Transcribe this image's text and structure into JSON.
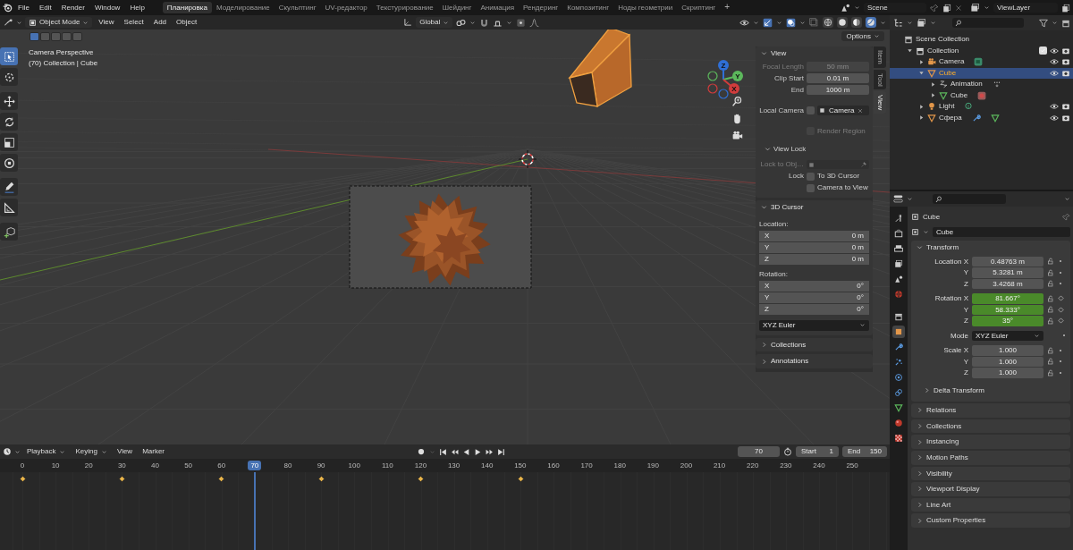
{
  "menu": [
    "File",
    "Edit",
    "Render",
    "Window",
    "Help"
  ],
  "workspaces": [
    {
      "label": "Планировка",
      "selected": true
    },
    {
      "label": "Моделирование",
      "selected": false
    },
    {
      "label": "Скульптинг",
      "selected": false
    },
    {
      "label": "UV-редактор",
      "selected": false
    },
    {
      "label": "Текстурирование",
      "selected": false
    },
    {
      "label": "Шейдинг",
      "selected": false
    },
    {
      "label": "Анимация",
      "selected": false
    },
    {
      "label": "Рендеринг",
      "selected": false
    },
    {
      "label": "Композитинг",
      "selected": false
    },
    {
      "label": "Ноды геометрии",
      "selected": false
    },
    {
      "label": "Скриптинг",
      "selected": false
    }
  ],
  "add_tab": "+",
  "scene": "Scene",
  "view_layer": "ViewLayer",
  "viewport": {
    "mode": "Object Mode",
    "menus": [
      "View",
      "Select",
      "Add",
      "Object"
    ],
    "orientation": "Global",
    "shading": [
      {
        "kind": "wireframe",
        "selected": false
      },
      {
        "kind": "solid",
        "selected": false
      },
      {
        "kind": "material",
        "selected": false
      },
      {
        "kind": "rendered",
        "selected": true
      }
    ],
    "options": "Options",
    "select_modes": [
      {
        "selected": true
      },
      {
        "selected": false
      },
      {
        "selected": false
      },
      {
        "selected": false
      },
      {
        "selected": false
      }
    ],
    "info": [
      "Camera Perspective",
      "(70) Collection | Cube"
    ],
    "tools": [
      {
        "kind": "select",
        "selected": true
      },
      {
        "kind": "cursor",
        "selected": false
      },
      {
        "kind": "move",
        "selected": false
      },
      {
        "kind": "rotate",
        "selected": false
      },
      {
        "kind": "scale",
        "selected": false
      },
      {
        "kind": "transform",
        "selected": false
      },
      {
        "kind": "annotate",
        "selected": false
      },
      {
        "kind": "measure",
        "selected": false
      },
      {
        "kind": "add-cube",
        "selected": false
      }
    ],
    "gizmo": [
      "Z",
      "Y",
      "X"
    ],
    "npanel": {
      "tabs": [
        {
          "label": "Item",
          "selected": false
        },
        {
          "label": "Tool",
          "selected": false
        },
        {
          "label": "View",
          "selected": true
        }
      ],
      "sections": [
        {
          "title": "View",
          "expanded": true,
          "rows": [
            {
              "kind": "field",
              "label": "Focal Length",
              "value": "50 mm",
              "disabled": true
            },
            {
              "kind": "field",
              "label": "Clip Start",
              "value": "0.01 m",
              "disabled": false
            },
            {
              "kind": "field",
              "label": "End",
              "value": "1000 m",
              "disabled": false
            },
            {
              "kind": "camera",
              "label": "Local Camera",
              "value": "Camera",
              "checked": false,
              "disabled": false
            },
            {
              "kind": "check",
              "text": "Render Region",
              "checked": false,
              "disabled": true
            },
            {
              "kind": "subheader",
              "title": "View Lock",
              "expanded": true,
              "disabled": false
            },
            {
              "kind": "pick",
              "label": "Lock to Obj…",
              "disabled": true
            },
            {
              "kind": "check",
              "label": "Lock",
              "text": "To 3D Cursor",
              "checked": false,
              "disabled": false
            },
            {
              "kind": "check",
              "text": "Camera to View",
              "checked": false,
              "disabled": false
            }
          ]
        },
        {
          "title": "3D Cursor",
          "expanded": true,
          "rows": [
            {
              "kind": "caption",
              "label": "Location:",
              "disabled": false
            },
            {
              "kind": "axis",
              "label": "X",
              "value": "0 m",
              "disabled": false
            },
            {
              "kind": "axis",
              "label": "Y",
              "value": "0 m",
              "disabled": false
            },
            {
              "kind": "axis",
              "label": "Z",
              "value": "0 m",
              "disabled": false
            },
            {
              "kind": "caption",
              "label": "Rotation:",
              "disabled": false
            },
            {
              "kind": "axis",
              "label": "X",
              "value": "0°",
              "disabled": false
            },
            {
              "kind": "axis",
              "label": "Y",
              "value": "0°",
              "disabled": false
            },
            {
              "kind": "axis",
              "label": "Z",
              "value": "0°",
              "disabled": false
            },
            {
              "kind": "select",
              "value": "XYZ Euler",
              "disabled": false
            }
          ]
        },
        {
          "title": "Collections",
          "expanded": false
        },
        {
          "title": "Annotations",
          "expanded": false
        }
      ]
    }
  },
  "outliner": {
    "items": [
      {
        "label": "Scene Collection",
        "kind": "scene-collection",
        "selected": false,
        "children": [
          {
            "label": "Collection",
            "kind": "collection",
            "expanded": true,
            "checked": true,
            "restrict": true,
            "selected": false,
            "children": [
              {
                "label": "Camera",
                "kind": "camera",
                "expanded": false,
                "restrict": true,
                "selected": false,
                "badges": [
                  {
                    "kind": "camera-data"
                  }
                ]
              },
              {
                "label": "Cube",
                "kind": "mesh-object",
                "expanded": true,
                "restrict": true,
                "selected": true,
                "children": [
                  {
                    "label": "Animation",
                    "kind": "animation",
                    "expanded": false,
                    "restrict": false,
                    "selected": false,
                    "badges": [
                      {
                        "kind": "action"
                      }
                    ]
                  },
                  {
                    "label": "Cube",
                    "kind": "mesh",
                    "expanded": false,
                    "restrict": false,
                    "selected": false,
                    "badges": [
                      {
                        "kind": "material"
                      }
                    ]
                  }
                ]
              },
              {
                "label": "Light",
                "kind": "light",
                "expanded": false,
                "restrict": true,
                "selected": false,
                "badges": [
                  {
                    "kind": "light-data"
                  }
                ]
              },
              {
                "label": "Сфера",
                "kind": "mesh-object",
                "expanded": false,
                "restrict": true,
                "selected": false,
                "badges": [
                  {
                    "kind": "modifier"
                  },
                  {
                    "kind": "mesh"
                  }
                ]
              }
            ]
          }
        ]
      }
    ]
  },
  "properties": {
    "tabs": [
      {
        "kind": "tool",
        "selected": false
      },
      {
        "kind": "render",
        "selected": false
      },
      {
        "kind": "output",
        "selected": false
      },
      {
        "kind": "view-layer",
        "selected": false
      },
      {
        "kind": "scene",
        "selected": false
      },
      {
        "kind": "world",
        "selected": false
      },
      {
        "kind": "collection",
        "selected": false
      },
      {
        "kind": "object",
        "selected": true
      },
      {
        "kind": "modifiers",
        "selected": false
      },
      {
        "kind": "particles",
        "selected": false
      },
      {
        "kind": "physics",
        "selected": false
      },
      {
        "kind": "constraints",
        "selected": false
      },
      {
        "kind": "data",
        "selected": false
      },
      {
        "kind": "material",
        "selected": false
      },
      {
        "kind": "texture",
        "selected": false
      }
    ],
    "context": "Cube",
    "object_name": "Cube",
    "transform": {
      "title": "Transform",
      "expanded": true,
      "rows": [
        {
          "kind": "vector",
          "keyframed": false,
          "fields": [
            {
              "label": "Location X",
              "value": "0.48763 m"
            },
            {
              "label": "Y",
              "value": "5.3281 m"
            },
            {
              "label": "Z",
              "value": "3.4268 m"
            }
          ]
        },
        {
          "kind": "vector",
          "keyframed": true,
          "fields": [
            {
              "label": "Rotation X",
              "value": "81.667°"
            },
            {
              "label": "Y",
              "value": "58.333°"
            },
            {
              "label": "Z",
              "value": "35°"
            }
          ]
        },
        {
          "kind": "select",
          "label": "Mode",
          "value": "XYZ Euler"
        },
        {
          "kind": "vector",
          "keyframed": false,
          "fields": [
            {
              "label": "Scale X",
              "value": "1.000"
            },
            {
              "label": "Y",
              "value": "1.000"
            },
            {
              "label": "Z",
              "value": "1.000"
            }
          ]
        }
      ],
      "subpanels": [
        {
          "title": "Delta Transform",
          "expanded": false
        }
      ]
    },
    "sections": [
      {
        "title": "Relations",
        "expanded": false
      },
      {
        "title": "Collections",
        "expanded": false
      },
      {
        "title": "Instancing",
        "expanded": false
      },
      {
        "title": "Motion Paths",
        "expanded": false
      },
      {
        "title": "Visibility",
        "expanded": false
      },
      {
        "title": "Viewport Display",
        "expanded": false
      },
      {
        "title": "Line Art",
        "expanded": false
      },
      {
        "title": "Custom Properties",
        "expanded": false
      }
    ]
  },
  "timeline": {
    "menus": [
      "Playback",
      "Keying",
      "View",
      "Marker"
    ],
    "current_frame": "70",
    "start_label": "Start",
    "start": "1",
    "end_label": "End",
    "end": "150",
    "ruler": [
      {
        "label": "0",
        "selected": false,
        "keyframe": true
      },
      {
        "label": "10",
        "selected": false,
        "keyframe": false
      },
      {
        "label": "20",
        "selected": false,
        "keyframe": false
      },
      {
        "label": "30",
        "selected": false,
        "keyframe": true
      },
      {
        "label": "40",
        "selected": false,
        "keyframe": false
      },
      {
        "label": "50",
        "selected": false,
        "keyframe": false
      },
      {
        "label": "60",
        "selected": false,
        "keyframe": true
      },
      {
        "label": "70",
        "selected": true,
        "keyframe": false
      },
      {
        "label": "80",
        "selected": false,
        "keyframe": false
      },
      {
        "label": "90",
        "selected": false,
        "keyframe": true
      },
      {
        "label": "100",
        "selected": false,
        "keyframe": false
      },
      {
        "label": "110",
        "selected": false,
        "keyframe": false
      },
      {
        "label": "120",
        "selected": false,
        "keyframe": true
      },
      {
        "label": "130",
        "selected": false,
        "keyframe": false
      },
      {
        "label": "140",
        "selected": false,
        "keyframe": false
      },
      {
        "label": "150",
        "selected": false,
        "keyframe": true
      },
      {
        "label": "160",
        "selected": false,
        "keyframe": false
      },
      {
        "label": "170",
        "selected": false,
        "keyframe": false
      },
      {
        "label": "180",
        "selected": false,
        "keyframe": false
      },
      {
        "label": "190",
        "selected": false,
        "keyframe": false
      },
      {
        "label": "200",
        "selected": false,
        "keyframe": false
      },
      {
        "label": "210",
        "selected": false,
        "keyframe": false
      },
      {
        "label": "220",
        "selected": false,
        "keyframe": false
      },
      {
        "label": "230",
        "selected": false,
        "keyframe": false
      },
      {
        "label": "240",
        "selected": false,
        "keyframe": false
      },
      {
        "label": "250",
        "selected": false,
        "keyframe": false
      }
    ]
  }
}
